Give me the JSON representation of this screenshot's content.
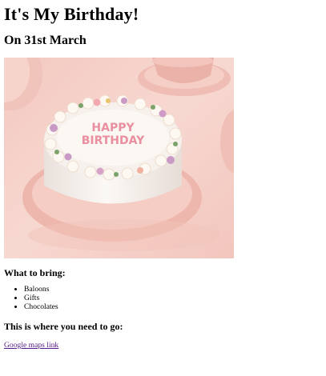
{
  "heading": "It's My Birthday!",
  "date_heading": "On 31st March",
  "image": {
    "cake_text_line1": "HAPPY",
    "cake_text_line2": "BIRTHDAY"
  },
  "bring": {
    "title": "What to bring:",
    "items": [
      "Baloons",
      "Gifts",
      "Chocolates"
    ]
  },
  "location": {
    "title": "This is where you need to go:",
    "link_text": "Google maps link"
  }
}
